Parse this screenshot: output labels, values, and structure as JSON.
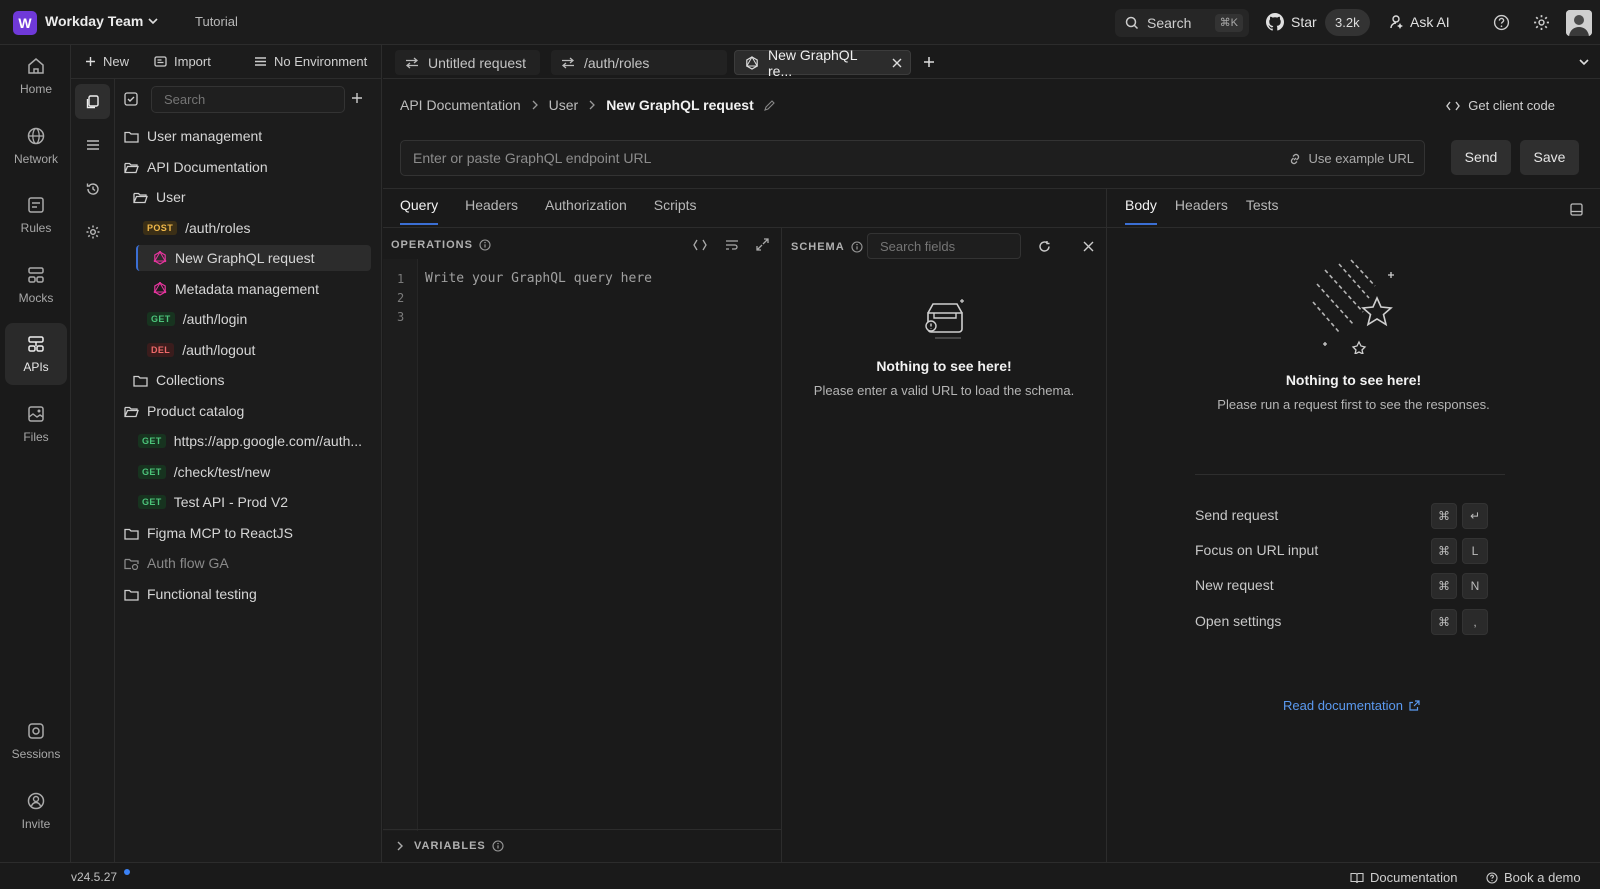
{
  "topbar": {
    "workspace_initial": "W",
    "workspace_name": "Workday Team",
    "tutorial": "Tutorial",
    "search_label": "Search",
    "search_kbd": "⌘K",
    "star_label": "Star",
    "star_count": "3.2k",
    "ask_ai": "Ask AI"
  },
  "rail": {
    "items": [
      {
        "label": "Home",
        "icon": "home-icon"
      },
      {
        "label": "Network",
        "icon": "globe-icon"
      },
      {
        "label": "Rules",
        "icon": "rules-icon"
      },
      {
        "label": "Mocks",
        "icon": "mocks-icon"
      },
      {
        "label": "APIs",
        "icon": "apis-icon"
      },
      {
        "label": "Files",
        "icon": "files-icon"
      }
    ],
    "bottom": [
      {
        "label": "Sessions",
        "icon": "sessions-icon"
      },
      {
        "label": "Invite",
        "icon": "invite-icon"
      }
    ]
  },
  "explorer": {
    "new_label": "New",
    "import_label": "Import",
    "env_label": "No Environment",
    "search_placeholder": "Search",
    "tree": [
      {
        "label": "User management"
      },
      {
        "label": "API Documentation"
      },
      {
        "label": "User"
      },
      {
        "method": "POST",
        "label": "/auth/roles"
      },
      {
        "label": "New GraphQL request"
      },
      {
        "label": "Metadata management"
      },
      {
        "method": "GET",
        "label": "/auth/login"
      },
      {
        "method": "DEL",
        "label": "/auth/logout"
      },
      {
        "label": "Collections"
      },
      {
        "label": "Product catalog"
      },
      {
        "method": "GET",
        "label": "https://app.google.com//auth..."
      },
      {
        "method": "GET",
        "label": "/check/test/new"
      },
      {
        "method": "GET",
        "label": "Test API - Prod V2"
      },
      {
        "label": "Figma MCP to ReactJS"
      },
      {
        "label": "Auth flow GA"
      },
      {
        "label": "Functional testing"
      }
    ]
  },
  "tabs": [
    {
      "label": "Untitled request"
    },
    {
      "label": "/auth/roles"
    },
    {
      "label": "New GraphQL re..."
    }
  ],
  "request": {
    "breadcrumb": [
      "API Documentation",
      "User",
      "New GraphQL request"
    ],
    "client_code": "Get client code",
    "url_placeholder": "Enter or paste GraphQL endpoint URL",
    "use_example": "Use example URL",
    "send": "Send",
    "save": "Save",
    "subtabs": [
      "Query",
      "Headers",
      "Authorization",
      "Scripts"
    ],
    "operations_label": "OPERATIONS",
    "line_numbers": [
      "1",
      "2",
      "3"
    ],
    "code_placeholder": "Write your GraphQL query here",
    "variables_label": "VARIABLES"
  },
  "schema": {
    "label": "SCHEMA",
    "search_placeholder": "Search fields",
    "empty_title": "Nothing to see here!",
    "empty_sub": "Please enter a valid URL to load the schema."
  },
  "response": {
    "tabs": [
      "Body",
      "Headers",
      "Tests"
    ],
    "empty_title": "Nothing to see here!",
    "empty_sub": "Please run a request first to see the responses.",
    "shortcuts": [
      {
        "label": "Send request",
        "keys": [
          "⌘",
          "↵"
        ]
      },
      {
        "label": "Focus on URL input",
        "keys": [
          "⌘",
          "L"
        ]
      },
      {
        "label": "New request",
        "keys": [
          "⌘",
          "N"
        ]
      },
      {
        "label": "Open settings",
        "keys": [
          "⌘",
          ","
        ]
      }
    ],
    "read_doc": "Read documentation"
  },
  "footer": {
    "version": "v24.5.27",
    "documentation": "Documentation",
    "book_demo": "Book a demo"
  }
}
